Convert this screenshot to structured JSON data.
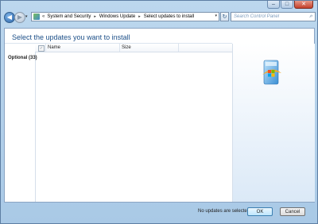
{
  "window": {
    "controls": {
      "minimize": "–",
      "maximize": "□",
      "close": "✕"
    }
  },
  "nav": {
    "back_glyph": "◀",
    "forward_glyph": "▶",
    "history_glyph": "▾"
  },
  "address": {
    "lead": "«",
    "crumbs": [
      "System and Security",
      "Windows Update",
      "Select updates to install"
    ],
    "separator": "▸",
    "dropdown_glyph": "▾",
    "refresh_glyph": "↻"
  },
  "search": {
    "placeholder": "Search Control Panel",
    "icon": "⌕"
  },
  "main": {
    "heading": "Select the updates you want to install",
    "columns": {
      "name": "Name",
      "size": "Size"
    },
    "header_checkbox": "✓",
    "categories": [
      {
        "label": "Optional (33)"
      }
    ]
  },
  "footer": {
    "status": "No updates are selected.",
    "ok_label": "OK",
    "cancel_label": "Cancel"
  }
}
